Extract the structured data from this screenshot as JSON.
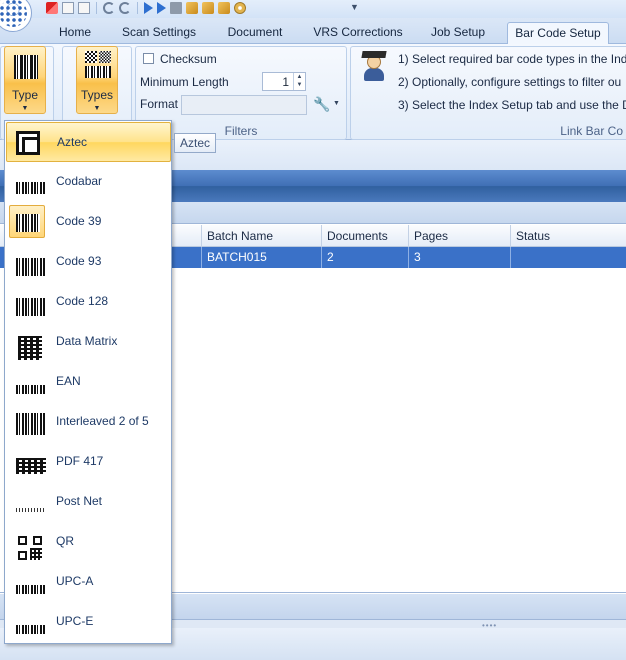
{
  "tabs": [
    {
      "label": "Home"
    },
    {
      "label": "Scan Settings"
    },
    {
      "label": "Document"
    },
    {
      "label": "VRS Corrections"
    },
    {
      "label": "Job Setup"
    },
    {
      "label": "Bar Code Setup"
    }
  ],
  "ribbon": {
    "type_button": "Type",
    "types_button": "Types",
    "filters": {
      "checksum_label": "Checksum",
      "min_length_label": "Minimum Length",
      "min_length_value": "1",
      "format_label": "Format",
      "format_value": "",
      "caption": "Filters"
    },
    "link": {
      "step1": "1) Select required bar code types in the Inde",
      "step2": "2) Optionally, configure settings to filter ou",
      "step3": "3) Select the Index Setup tab and use the De",
      "caption": "Link Bar Co"
    }
  },
  "dropdown": {
    "items": [
      {
        "label": "Aztec"
      },
      {
        "label": "Codabar"
      },
      {
        "label": "Code 39"
      },
      {
        "label": "Code 93"
      },
      {
        "label": "Code 128"
      },
      {
        "label": "Data Matrix"
      },
      {
        "label": "EAN"
      },
      {
        "label": "Interleaved 2 of 5"
      },
      {
        "label": "PDF 417"
      },
      {
        "label": "Post Net"
      },
      {
        "label": "QR"
      },
      {
        "label": "UPC-A"
      },
      {
        "label": "UPC-E"
      }
    ],
    "hovered": "Aztec",
    "selected": "Code 39"
  },
  "tooltip": "Aztec",
  "grid": {
    "columns": [
      "Batch Name",
      "Documents",
      "Pages",
      "Status"
    ],
    "rows": [
      {
        "batch_name": "BATCH015",
        "documents": "2",
        "pages": "3",
        "status": ""
      }
    ]
  },
  "colors": {
    "accent": "#3a71c8",
    "hover": "#ffd75e",
    "panel_header": "#3f6fb5"
  }
}
